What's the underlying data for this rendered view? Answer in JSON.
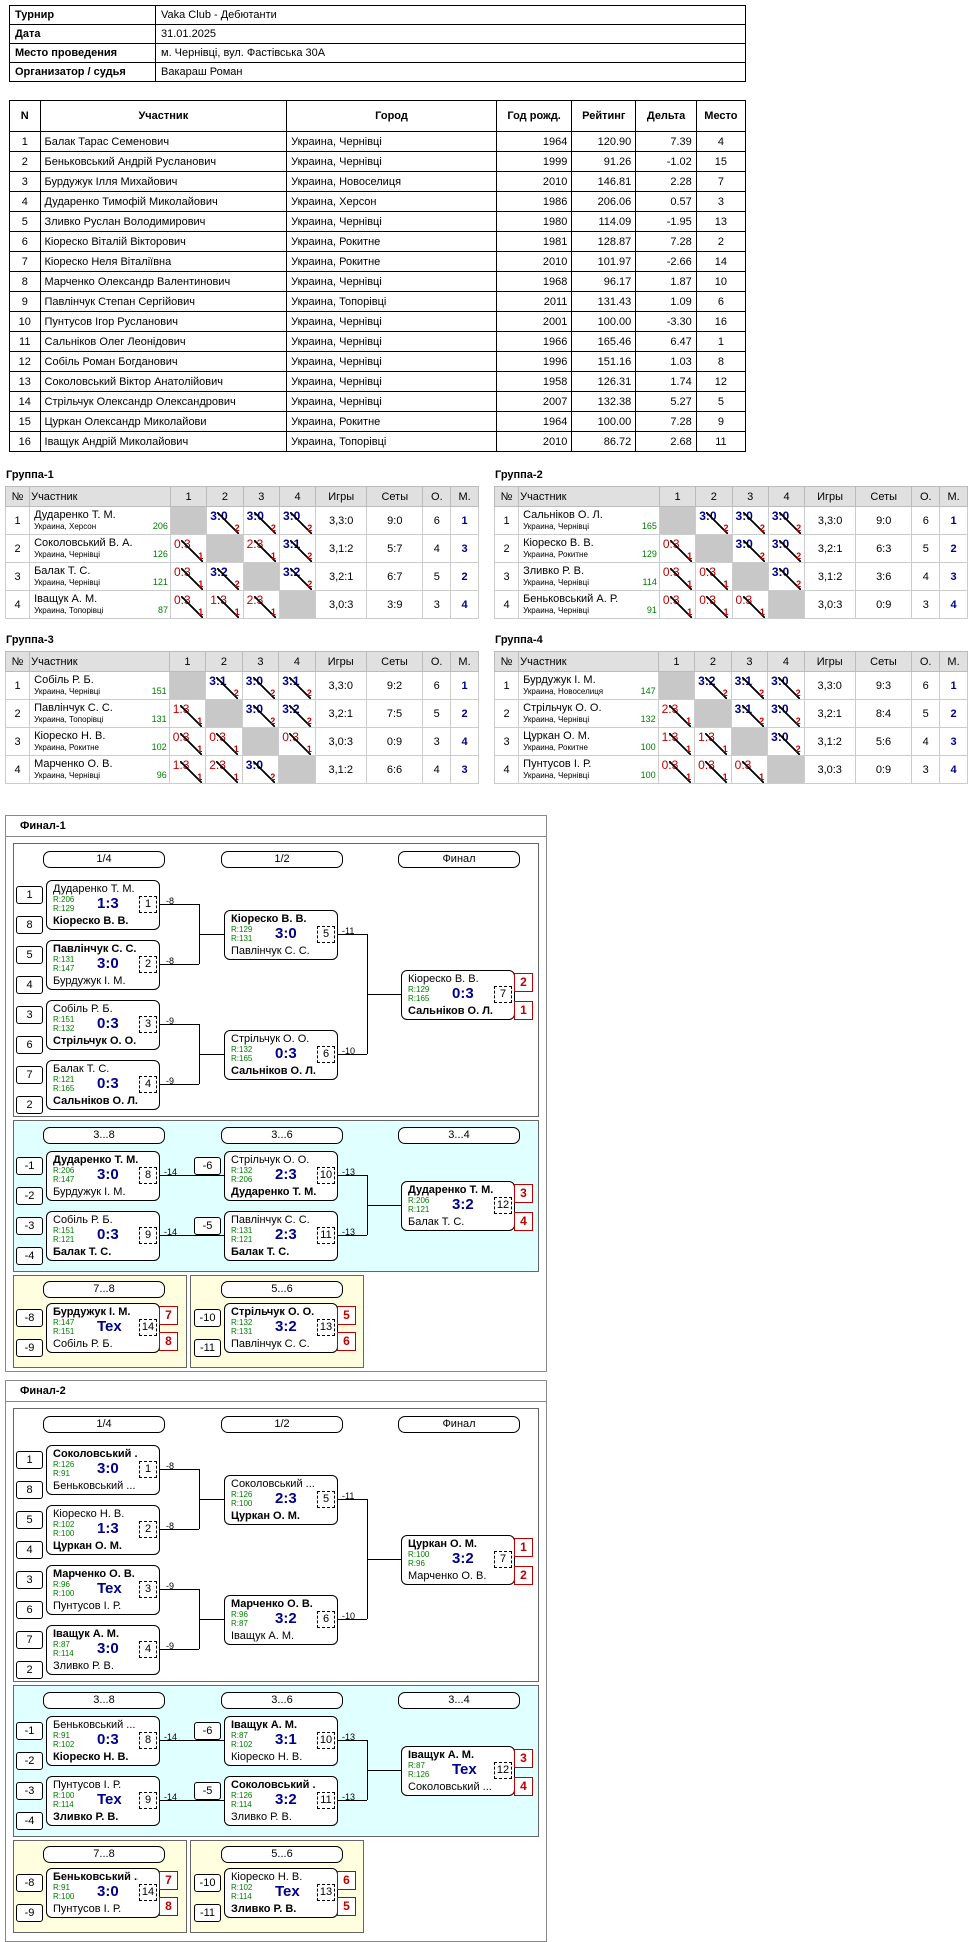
{
  "info": {
    "rows": [
      {
        "k": "Турнир",
        "v": "Vaka Club - Дебютанти"
      },
      {
        "k": "Дата",
        "v": "31.01.2025"
      },
      {
        "k": "Место проведения",
        "v": "м. Чернівці, вул. Фастівська 30А"
      },
      {
        "k": "Организатор / судья",
        "v": "Вакараш Роман"
      }
    ]
  },
  "participants": {
    "headers": [
      "N",
      "Участник",
      "Город",
      "Год рожд.",
      "Рейтинг",
      "Дельта",
      "Место"
    ],
    "rows": [
      [
        "1",
        "Балак Тарас Семенович",
        "Украина, Чернівці",
        "1964",
        "120.90",
        "7.39",
        "4"
      ],
      [
        "2",
        "Беньковський Андрій Русланович",
        "Украина, Чернівці",
        "1999",
        "91.26",
        "-1.02",
        "15"
      ],
      [
        "3",
        "Бурдужук Ілля Михайович",
        "Украина, Новоселиця",
        "2010",
        "146.81",
        "2.28",
        "7"
      ],
      [
        "4",
        "Дударенко Тимофій Миколайович",
        "Украина, Херсон",
        "1986",
        "206.06",
        "0.57",
        "3"
      ],
      [
        "5",
        "Зливко Руслан Володимирович",
        "Украина, Чернівці",
        "1980",
        "114.09",
        "-1.95",
        "13"
      ],
      [
        "6",
        "Кіореско Віталій Вікторович",
        "Украина, Рокитне",
        "1981",
        "128.87",
        "7.28",
        "2"
      ],
      [
        "7",
        "Кіореско Неля Віталіївна",
        "Украина, Рокитне",
        "2010",
        "101.97",
        "-2.66",
        "14"
      ],
      [
        "8",
        "Марченко Олександр Валентинович",
        "Украина, Чернівці",
        "1968",
        "96.17",
        "1.87",
        "10"
      ],
      [
        "9",
        "Павлінчук Степан Сергійович",
        "Украина, Топорівці",
        "2011",
        "131.43",
        "1.09",
        "6"
      ],
      [
        "10",
        "Пунтусов Ігор Русланович",
        "Украина, Чернівці",
        "2001",
        "100.00",
        "-3.30",
        "16"
      ],
      [
        "11",
        "Сальніков Олег Леонідович",
        "Украина, Чернівці",
        "1966",
        "165.46",
        "6.47",
        "1"
      ],
      [
        "12",
        "Собіль Роман Богданович",
        "Украина, Чернівці",
        "1996",
        "151.16",
        "1.03",
        "8"
      ],
      [
        "13",
        "Соколовський Віктор Анатолійович",
        "Украина, Чернівці",
        "1958",
        "126.31",
        "1.74",
        "12"
      ],
      [
        "14",
        "Стрільчук Олександр Олександрович",
        "Украина, Чернівці",
        "2007",
        "132.38",
        "5.27",
        "5"
      ],
      [
        "15",
        "Цуркан Олександр Миколайови",
        "Украина, Рокитне",
        "1964",
        "100.00",
        "7.28",
        "9"
      ],
      [
        "16",
        "Іващук Андрій Миколайович",
        "Украина, Топорівці",
        "2010",
        "86.72",
        "2.68",
        "11"
      ]
    ]
  },
  "group_headers": [
    "№",
    "Участник",
    "1",
    "2",
    "3",
    "4",
    "Игры",
    "Сеты",
    "О.",
    "М."
  ],
  "groups": [
    {
      "title": "Группа-1",
      "rows": [
        {
          "n": "1",
          "name": "Дударенко Т. М.",
          "city": "Украина, Херсон",
          "rating": "206",
          "cells": [
            "",
            [
              "3:0",
              "2"
            ],
            [
              "3:0",
              "2"
            ],
            [
              "3:0",
              "2"
            ]
          ],
          "games": "3,3:0",
          "sets": "9:0",
          "pts": "6",
          "place": "1"
        },
        {
          "n": "2",
          "name": "Соколовський В. А.",
          "city": "Украина, Чернівці",
          "rating": "126",
          "cells": [
            [
              "0:3",
              "1"
            ],
            "",
            [
              "2:3",
              "1"
            ],
            [
              "3:1",
              "2"
            ]
          ],
          "games": "3,1:2",
          "sets": "5:7",
          "pts": "4",
          "place": "3"
        },
        {
          "n": "3",
          "name": "Балак Т. С.",
          "city": "Украина, Чернівці",
          "rating": "121",
          "cells": [
            [
              "0:3",
              "1"
            ],
            [
              "3:2",
              "2"
            ],
            "",
            [
              "3:2",
              "2"
            ]
          ],
          "games": "3,2:1",
          "sets": "6:7",
          "pts": "5",
          "place": "2"
        },
        {
          "n": "4",
          "name": "Іващук А. М.",
          "city": "Украина, Топорівці",
          "rating": "87",
          "cells": [
            [
              "0:3",
              "1"
            ],
            [
              "1:3",
              "1"
            ],
            [
              "2:3",
              "1"
            ],
            ""
          ],
          "games": "3,0:3",
          "sets": "3:9",
          "pts": "3",
          "place": "4"
        }
      ]
    },
    {
      "title": "Группа-2",
      "rows": [
        {
          "n": "1",
          "name": "Сальніков О. Л.",
          "city": "Украина, Чернівці",
          "rating": "165",
          "cells": [
            "",
            [
              "3:0",
              "2"
            ],
            [
              "3:0",
              "2"
            ],
            [
              "3:0",
              "2"
            ]
          ],
          "games": "3,3:0",
          "sets": "9:0",
          "pts": "6",
          "place": "1"
        },
        {
          "n": "2",
          "name": "Кіореско В. В.",
          "city": "Украина, Рокитне",
          "rating": "129",
          "cells": [
            [
              "0:3",
              "1"
            ],
            "",
            [
              "3:0",
              "2"
            ],
            [
              "3:0",
              "2"
            ]
          ],
          "games": "3,2:1",
          "sets": "6:3",
          "pts": "5",
          "place": "2"
        },
        {
          "n": "3",
          "name": "Зливко Р. В.",
          "city": "Украина, Чернівці",
          "rating": "114",
          "cells": [
            [
              "0:3",
              "1"
            ],
            [
              "0:3",
              "1"
            ],
            "",
            [
              "3:0",
              "2"
            ]
          ],
          "games": "3,1:2",
          "sets": "3:6",
          "pts": "4",
          "place": "3"
        },
        {
          "n": "4",
          "name": "Беньковський А. Р.",
          "city": "Украина, Чернівці",
          "rating": "91",
          "cells": [
            [
              "0:3",
              "1"
            ],
            [
              "0:3",
              "1"
            ],
            [
              "0:3",
              "1"
            ],
            ""
          ],
          "games": "3,0:3",
          "sets": "0:9",
          "pts": "3",
          "place": "4"
        }
      ]
    },
    {
      "title": "Группа-3",
      "rows": [
        {
          "n": "1",
          "name": "Собіль Р. Б.",
          "city": "Украина, Чернівці",
          "rating": "151",
          "cells": [
            "",
            [
              "3:1",
              "2"
            ],
            [
              "3:0",
              "2"
            ],
            [
              "3:1",
              "2"
            ]
          ],
          "games": "3,3:0",
          "sets": "9:2",
          "pts": "6",
          "place": "1"
        },
        {
          "n": "2",
          "name": "Павлінчук С. С.",
          "city": "Украина, Топорівці",
          "rating": "131",
          "cells": [
            [
              "1:3",
              "1"
            ],
            "",
            [
              "3:0",
              "2"
            ],
            [
              "3:2",
              "2"
            ]
          ],
          "games": "3,2:1",
          "sets": "7:5",
          "pts": "5",
          "place": "2"
        },
        {
          "n": "3",
          "name": "Кіореско Н. В.",
          "city": "Украина, Рокитне",
          "rating": "102",
          "cells": [
            [
              "0:3",
              "1"
            ],
            [
              "0:3",
              "1"
            ],
            "",
            [
              "0:3",
              "1"
            ]
          ],
          "games": "3,0:3",
          "sets": "0:9",
          "pts": "3",
          "place": "4"
        },
        {
          "n": "4",
          "name": "Марченко О. В.",
          "city": "Украина, Чернівці",
          "rating": "96",
          "cells": [
            [
              "1:3",
              "1"
            ],
            [
              "2:3",
              "1"
            ],
            [
              "3:0",
              "2"
            ],
            ""
          ],
          "games": "3,1:2",
          "sets": "6:6",
          "pts": "4",
          "place": "3"
        }
      ]
    },
    {
      "title": "Группа-4",
      "rows": [
        {
          "n": "1",
          "name": "Бурдужук І. М.",
          "city": "Украина, Новоселиця",
          "rating": "147",
          "cells": [
            "",
            [
              "3:2",
              "2"
            ],
            [
              "3:1",
              "2"
            ],
            [
              "3:0",
              "2"
            ]
          ],
          "games": "3,3:0",
          "sets": "9:3",
          "pts": "6",
          "place": "1"
        },
        {
          "n": "2",
          "name": "Стрільчук О. О.",
          "city": "Украина, Чернівці",
          "rating": "132",
          "cells": [
            [
              "2:3",
              "1"
            ],
            "",
            [
              "3:1",
              "2"
            ],
            [
              "3:0",
              "2"
            ]
          ],
          "games": "3,2:1",
          "sets": "8:4",
          "pts": "5",
          "place": "2"
        },
        {
          "n": "3",
          "name": "Цуркан О. М.",
          "city": "Украина, Рокитне",
          "rating": "100",
          "cells": [
            [
              "1:3",
              "1"
            ],
            [
              "1:3",
              "1"
            ],
            "",
            [
              "3:0",
              "2"
            ]
          ],
          "games": "3,1:2",
          "sets": "5:6",
          "pts": "4",
          "place": "3"
        },
        {
          "n": "4",
          "name": "Пунтусов І. Р.",
          "city": "Украина, Чернівці",
          "rating": "100",
          "cells": [
            [
              "0:3",
              "1"
            ],
            [
              "0:3",
              "1"
            ],
            [
              "0:3",
              "1"
            ],
            ""
          ],
          "games": "3,0:3",
          "sets": "0:9",
          "pts": "3",
          "place": "4"
        }
      ]
    }
  ],
  "finals": [
    {
      "title": "Финал-1",
      "round_labels": [
        "1/4",
        "1/2",
        "Финал",
        "3...8",
        "3...6",
        "3...4",
        "7...8",
        "5...6"
      ],
      "matches": [
        {
          "a": "Дударенко Т. М.",
          "ra": "R:206",
          "b": "Кіореско В. В.",
          "rb": "R:129",
          "score": "1:3",
          "num": "1",
          "win": "b"
        },
        {
          "a": "Павлінчук С. С.",
          "ra": "R:131",
          "b": "Бурдужук І. М.",
          "rb": "R:147",
          "score": "3:0",
          "num": "2",
          "win": "a"
        },
        {
          "a": "Собіль Р. Б.",
          "ra": "R:151",
          "b": "Стрільчук О. О.",
          "rb": "R:132",
          "score": "0:3",
          "num": "3",
          "win": "b"
        },
        {
          "a": "Балак Т. С.",
          "ra": "R:121",
          "b": "Сальніков О. Л.",
          "rb": "R:165",
          "score": "0:3",
          "num": "4",
          "win": "b"
        },
        {
          "a": "Кіореско В. В.",
          "ra": "R:129",
          "b": "Павлінчук С. С.",
          "rb": "R:131",
          "score": "3:0",
          "num": "5",
          "win": "a"
        },
        {
          "a": "Стрільчук О. О.",
          "ra": "R:132",
          "b": "Сальніков О. Л.",
          "rb": "R:165",
          "score": "0:3",
          "num": "6",
          "win": "b"
        },
        {
          "a": "Кіореско В. В.",
          "ra": "R:129",
          "b": "Сальніков О. Л.",
          "rb": "R:165",
          "score": "0:3",
          "num": "7",
          "win": "b"
        },
        {
          "a": "Дударенко Т. М.",
          "ra": "R:206",
          "b": "Бурдужук І. М.",
          "rb": "R:147",
          "score": "3:0",
          "num": "8",
          "win": "a"
        },
        {
          "a": "Собіль Р. Б.",
          "ra": "R:151",
          "b": "Балак Т. С.",
          "rb": "R:121",
          "score": "0:3",
          "num": "9",
          "win": "b"
        },
        {
          "a": "Стрільчук О. О.",
          "ra": "R:132",
          "b": "Дударенко Т. М.",
          "rb": "R:206",
          "score": "2:3",
          "num": "10",
          "win": "b"
        },
        {
          "a": "Павлінчук С. С.",
          "ra": "R:131",
          "b": "Балак Т. С.",
          "rb": "R:121",
          "score": "2:3",
          "num": "11",
          "win": "b"
        },
        {
          "a": "Дударенко Т. М.",
          "ra": "R:206",
          "b": "Балак Т. С.",
          "rb": "R:121",
          "score": "3:2",
          "num": "12",
          "win": "a"
        },
        {
          "a": "Стрільчук О. О.",
          "ra": "R:132",
          "b": "Павлінчук С. С.",
          "rb": "R:131",
          "score": "3:2",
          "num": "13",
          "win": "a"
        },
        {
          "a": "Бурдужук І. М.",
          "ra": "R:147",
          "b": "Собіль Р. Б.",
          "rb": "R:151",
          "score": "Tex",
          "num": "14",
          "win": "a"
        }
      ],
      "seeds": [
        "1",
        "8",
        "5",
        "4",
        "3",
        "6",
        "7",
        "2",
        "-1",
        "-2",
        "-3",
        "-4",
        "-6",
        "-5",
        "-8",
        "-9",
        "-10",
        "-11"
      ],
      "links": [
        "-8",
        "-8",
        "-9",
        "-9",
        "-11",
        "-10",
        "-14",
        "-14",
        "-13",
        "-13"
      ],
      "places": [
        "2",
        "1",
        "3",
        "4",
        "7",
        "8",
        "5",
        "6"
      ]
    },
    {
      "title": "Финал-2",
      "round_labels": [
        "1/4",
        "1/2",
        "Финал",
        "3...8",
        "3...6",
        "3...4",
        "7...8",
        "5...6"
      ],
      "matches": [
        {
          "a": "Соколовський ...",
          "ra": "R:126",
          "b": "Беньковський ...",
          "rb": "R:91",
          "score": "3:0",
          "num": "1",
          "win": "a"
        },
        {
          "a": "Кіореско Н. В.",
          "ra": "R:102",
          "b": "Цуркан О. М.",
          "rb": "R:100",
          "score": "1:3",
          "num": "2",
          "win": "b"
        },
        {
          "a": "Марченко О. В.",
          "ra": "R:96",
          "b": "Пунтусов І. Р.",
          "rb": "R:100",
          "score": "Tex",
          "num": "3",
          "win": "a"
        },
        {
          "a": "Іващук А. М.",
          "ra": "R:87",
          "b": "Зливко Р. В.",
          "rb": "R:114",
          "score": "3:0",
          "num": "4",
          "win": "a"
        },
        {
          "a": "Соколовський ...",
          "ra": "R:126",
          "b": "Цуркан О. М.",
          "rb": "R:100",
          "score": "2:3",
          "num": "5",
          "win": "b"
        },
        {
          "a": "Марченко О. В.",
          "ra": "R:96",
          "b": "Іващук А. М.",
          "rb": "R:87",
          "score": "3:2",
          "num": "6",
          "win": "a"
        },
        {
          "a": "Цуркан О. М.",
          "ra": "R:100",
          "b": "Марченко О. В.",
          "rb": "R:96",
          "score": "3:2",
          "num": "7",
          "win": "a"
        },
        {
          "a": "Беньковський ...",
          "ra": "R:91",
          "b": "Кіореско Н. В.",
          "rb": "R:102",
          "score": "0:3",
          "num": "8",
          "win": "b"
        },
        {
          "a": "Пунтусов І. Р.",
          "ra": "R:100",
          "b": "Зливко Р. В.",
          "rb": "R:114",
          "score": "Tex",
          "num": "9",
          "win": "b"
        },
        {
          "a": "Іващук А. М.",
          "ra": "R:87",
          "b": "Кіореско Н. В.",
          "rb": "R:102",
          "score": "3:1",
          "num": "10",
          "win": "a"
        },
        {
          "a": "Соколовський ...",
          "ra": "R:126",
          "b": "Зливко Р. В.",
          "rb": "R:114",
          "score": "3:2",
          "num": "11",
          "win": "a"
        },
        {
          "a": "Іващук А. М.",
          "ra": "R:87",
          "b": "Соколовський ...",
          "rb": "R:126",
          "score": "Tex",
          "num": "12",
          "win": "a"
        },
        {
          "a": "Кіореско Н. В.",
          "ra": "R:102",
          "b": "Зливко Р. В.",
          "rb": "R:114",
          "score": "Tex",
          "num": "13",
          "win": "b"
        },
        {
          "a": "Беньковський ...",
          "ra": "R:91",
          "b": "Пунтусов І. Р.",
          "rb": "R:100",
          "score": "3:0",
          "num": "14",
          "win": "a"
        }
      ],
      "seeds": [
        "1",
        "8",
        "5",
        "4",
        "3",
        "6",
        "7",
        "2",
        "-1",
        "-2",
        "-3",
        "-4",
        "-6",
        "-5",
        "-8",
        "-9",
        "-10",
        "-11"
      ],
      "links": [
        "-8",
        "-8",
        "-9",
        "-9",
        "-11",
        "-10",
        "-14",
        "-14",
        "-13",
        "-13"
      ],
      "places": [
        "1",
        "2",
        "3",
        "4",
        "7",
        "8",
        "6",
        "5"
      ]
    }
  ]
}
